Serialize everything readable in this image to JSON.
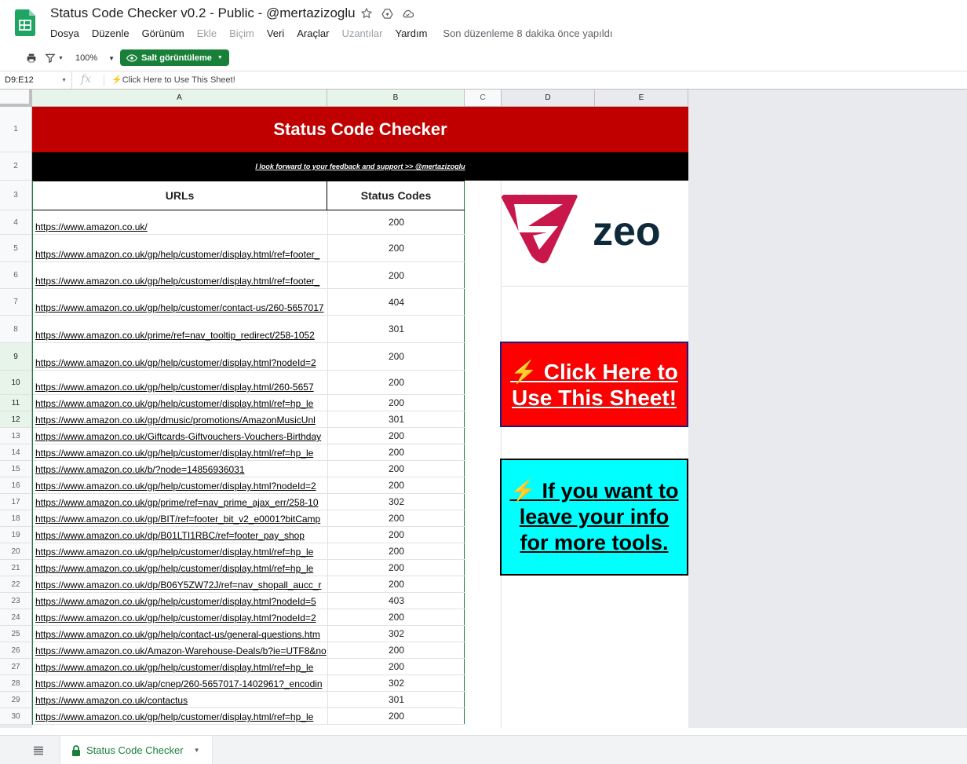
{
  "app": {
    "doc_title": "Status Code Checker v0.2 - Public - @mertazizoglu",
    "menu": [
      {
        "label": "Dosya",
        "enabled": true
      },
      {
        "label": "Düzenle",
        "enabled": true
      },
      {
        "label": "Görünüm",
        "enabled": true
      },
      {
        "label": "Ekle",
        "enabled": false
      },
      {
        "label": "Biçim",
        "enabled": false
      },
      {
        "label": "Veri",
        "enabled": true
      },
      {
        "label": "Araçlar",
        "enabled": true
      },
      {
        "label": "Uzantılar",
        "enabled": false
      },
      {
        "label": "Yardım",
        "enabled": true
      }
    ],
    "last_edit": "Son düzenleme 8 dakika önce yapıldı"
  },
  "toolbar": {
    "zoom": "100%",
    "view_mode": "Salt görüntüleme"
  },
  "formula_bar": {
    "name_box": "D9:E12",
    "content": "⚡Click Here to Use This Sheet!"
  },
  "columns": [
    "A",
    "B",
    "C",
    "D",
    "E"
  ],
  "sheet": {
    "banner": "Status Code Checker",
    "subbanner": "I look forward to your feedback and support  >> @mertazizoglu",
    "header_urls": "URLs",
    "header_status": "Status Codes",
    "rows": [
      {
        "n": "4",
        "url": "https://www.amazon.co.uk/",
        "status": "200"
      },
      {
        "n": "5",
        "url": "https://www.amazon.co.uk/gp/help/customer/display.html/ref=footer_",
        "status": "200"
      },
      {
        "n": "6",
        "url": "https://www.amazon.co.uk/gp/help/customer/display.html/ref=footer_",
        "status": "200"
      },
      {
        "n": "7",
        "url": "https://www.amazon.co.uk/gp/help/customer/contact-us/260-5657017",
        "status": "404"
      },
      {
        "n": "8",
        "url": "https://www.amazon.co.uk/prime/ref=nav_tooltip_redirect/258-1052",
        "status": "301"
      },
      {
        "n": "9",
        "url": "https://www.amazon.co.uk/gp/help/customer/display.html?nodeId=2",
        "status": "200"
      },
      {
        "n": "10",
        "url": "https://www.amazon.co.uk/gp/help/customer/display.html/260-5657",
        "status": "200"
      },
      {
        "n": "11",
        "url": "https://www.amazon.co.uk/gp/help/customer/display.html/ref=hp_le",
        "status": "200"
      },
      {
        "n": "12",
        "url": "https://www.amazon.co.uk/gp/dmusic/promotions/AmazonMusicUnl",
        "status": "301"
      },
      {
        "n": "13",
        "url": "https://www.amazon.co.uk/Giftcards-Giftvouchers-Vouchers-Birthday",
        "status": "200"
      },
      {
        "n": "14",
        "url": "https://www.amazon.co.uk/gp/help/customer/display.html/ref=hp_le",
        "status": "200"
      },
      {
        "n": "15",
        "url": "https://www.amazon.co.uk/b/?node=14856936031",
        "status": "200"
      },
      {
        "n": "16",
        "url": "https://www.amazon.co.uk/gp/help/customer/display.html?nodeId=2",
        "status": "200"
      },
      {
        "n": "17",
        "url": "https://www.amazon.co.uk/gp/prime/ref=nav_prime_ajax_err/258-10",
        "status": "302"
      },
      {
        "n": "18",
        "url": "https://www.amazon.co.uk/gp/BIT/ref=footer_bit_v2_e0001?bitCamp",
        "status": "200"
      },
      {
        "n": "19",
        "url": "https://www.amazon.co.uk/dp/B01LTI1RBC/ref=footer_pay_shop",
        "status": "200"
      },
      {
        "n": "20",
        "url": "https://www.amazon.co.uk/gp/help/customer/display.html/ref=hp_le",
        "status": "200"
      },
      {
        "n": "21",
        "url": "https://www.amazon.co.uk/gp/help/customer/display.html/ref=hp_le",
        "status": "200"
      },
      {
        "n": "22",
        "url": "https://www.amazon.co.uk/dp/B06Y5ZW72J/ref=nav_shopall_aucc_r",
        "status": "200"
      },
      {
        "n": "23",
        "url": "https://www.amazon.co.uk/gp/help/customer/display.html?nodeId=5",
        "status": "403"
      },
      {
        "n": "24",
        "url": "https://www.amazon.co.uk/gp/help/customer/display.html?nodeId=2",
        "status": "200"
      },
      {
        "n": "25",
        "url": "https://www.amazon.co.uk/gp/help/contact-us/general-questions.htm",
        "status": "302"
      },
      {
        "n": "26",
        "url": "https://www.amazon.co.uk/Amazon-Warehouse-Deals/b?ie=UTF8&no",
        "status": "200"
      },
      {
        "n": "27",
        "url": "https://www.amazon.co.uk/gp/help/customer/display.html/ref=hp_le",
        "status": "200"
      },
      {
        "n": "28",
        "url": "https://www.amazon.co.uk/ap/cnep/260-5657017-1402961?_encodin",
        "status": "302"
      },
      {
        "n": "29",
        "url": "https://www.amazon.co.uk/contactus",
        "status": "301"
      },
      {
        "n": "30",
        "url": "https://www.amazon.co.uk/gp/help/customer/display.html/ref=hp_le",
        "status": "200"
      }
    ],
    "logo_text": "zeo",
    "cta_red": "⚡ Click Here to Use This Sheet!",
    "cta_cyan": "⚡ If you want to leave your info for more tools."
  },
  "sheet_tab": {
    "label": "Status Code Checker"
  },
  "colors": {
    "banner_red": "#c00000",
    "cta_red": "#ff0000",
    "cta_cyan": "#00ffff",
    "brand_green": "#188038",
    "zeo_pink": "#c8174a",
    "zeo_navy": "#0e2a3a"
  }
}
